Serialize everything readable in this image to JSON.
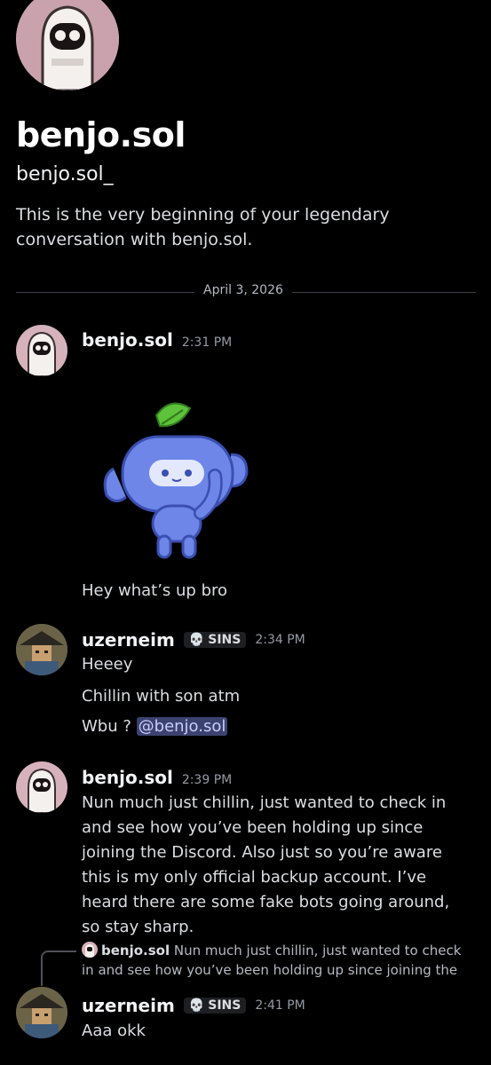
{
  "profile": {
    "display_name": "benjo.sol",
    "username": "benjo.sol_",
    "intro": "This is the very beginning of your legendary conversation with benjo.sol."
  },
  "divider": {
    "date": "April 3, 2026"
  },
  "messages": [
    {
      "author": "benjo.sol",
      "time": "2:31 PM",
      "sticker": "wumpus-sticker",
      "text": "Hey what’s up bro"
    },
    {
      "author": "uzerneim",
      "badge": "SINS",
      "time": "2:34 PM",
      "lines": [
        "Heeey",
        "Chillin with son atm"
      ],
      "wbu_prefix": "Wbu ? ",
      "mention": "@benjo.sol"
    },
    {
      "author": "benjo.sol",
      "time": "2:39 PM",
      "text": "Nun much just chillin, just wanted to check in and see how you’ve been holding up since joining the Discord. Also just so you’re aware this is my only official backup account. I’ve heard there are some fake bots going around, so stay sharp."
    },
    {
      "reply": {
        "author": "benjo.sol",
        "text": "Nun much just chillin, just wanted to check in and see how you’ve been holding up since joining the"
      },
      "author": "uzerneim",
      "badge": "SINS",
      "time": "2:41 PM",
      "text": "Aaa okk"
    }
  ],
  "colors": {
    "background": "#000000",
    "mention_bg": "#3c4270",
    "mention_fg": "#c9cdfb",
    "sticker_blue": "#6d86e8",
    "leaf_green": "#5ec23a"
  }
}
